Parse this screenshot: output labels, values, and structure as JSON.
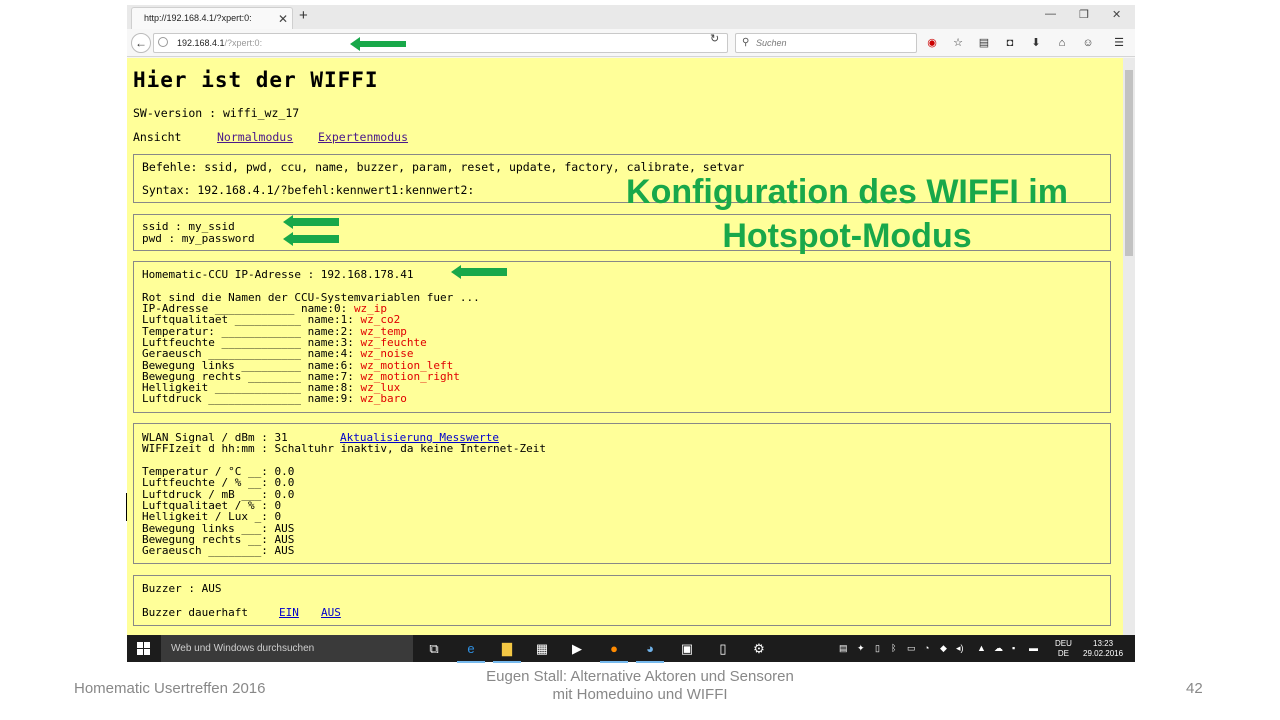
{
  "browser": {
    "tab_title": "http://192.168.4.1/?xpert:0:",
    "tab_close": "✕",
    "new_tab": "+",
    "url_host": "192.168.4.1",
    "url_path": "/?xpert:0:",
    "search_placeholder": "Suchen"
  },
  "page": {
    "title": "Hier ist der WIFFI",
    "sw_version": "SW-version : wiffi_wz_17",
    "ansicht_label": "Ansicht",
    "mode_links": [
      "Normalmodus",
      "Expertenmodus"
    ],
    "commands_line": "Befehle: ssid, pwd, ccu, name, buzzer, param, reset, update, factory, calibrate, setvar",
    "syntax_line": "Syntax: 192.168.4.1/?befehl:kennwert1:kennwert2:",
    "ssid_line": "ssid : my_ssid",
    "pwd_line": "pwd : my_password",
    "ccu_line": "Homematic-CCU IP-Adresse : 192.168.178.41",
    "red_intro": "Rot sind die Namen der CCU-Systemvariablen fuer ...",
    "variables": [
      {
        "label": "IP-Adresse ____________ name:0:",
        "value": "wz_ip"
      },
      {
        "label": "Luftqualitaet __________ name:1:",
        "value": "wz_co2"
      },
      {
        "label": "Temperatur: ____________ name:2:",
        "value": "wz_temp"
      },
      {
        "label": "Luftfeuchte ____________ name:3:",
        "value": "wz_feuchte"
      },
      {
        "label": "Geraeusch ______________ name:4:",
        "value": "wz_noise"
      },
      {
        "label": "Bewegung links _________ name:6:",
        "value": "wz_motion_left"
      },
      {
        "label": "Bewegung rechts ________ name:7:",
        "value": "wz_motion_right"
      },
      {
        "label": "Helligkeit _____________ name:8:",
        "value": "wz_lux"
      },
      {
        "label": "Luftdruck ______________ name:9:",
        "value": "wz_baro"
      }
    ],
    "wlan_line": "WLAN Signal / dBm : 31",
    "update_link": "Aktualisierung Messwerte",
    "wiffizeit_line": "WIFFIzeit d hh:mm : Schaltuhr inaktiv, da keine Internet-Zeit",
    "measurements": [
      "Temperatur / °C __: 0.0",
      "Luftfeuchte / % __: 0.0",
      "Luftdruck / mB ___: 0.0",
      "Luftqualitaet / % : 0",
      "Helligkeit / Lux _: 0",
      "Bewegung links ___: AUS",
      "Bewegung rechts __: AUS",
      "Geraeusch ________: AUS"
    ],
    "buzzer_line": "Buzzer : AUS",
    "buzzer_perm_label": "Buzzer dauerhaft",
    "buzzer_links": [
      "EIN",
      "AUS"
    ]
  },
  "overlay": {
    "line1": "Konfiguration des WIFFI im",
    "line2": "Hotspot-Modus",
    "arrow_color": "#18a84a"
  },
  "taskbar": {
    "search_text": "Web und Windows durchsuchen",
    "lang_top": "DEU",
    "lang_bottom": "DE",
    "time": "13:23",
    "date": "29.02.2016"
  },
  "slide": {
    "footer_left": "Homematic Usertreffen 2016",
    "footer_center_1": "Eugen Stall:  Alternative Aktoren und Sensoren",
    "footer_center_2": "mit Homeduino und WIFFI",
    "page_number": "42"
  }
}
